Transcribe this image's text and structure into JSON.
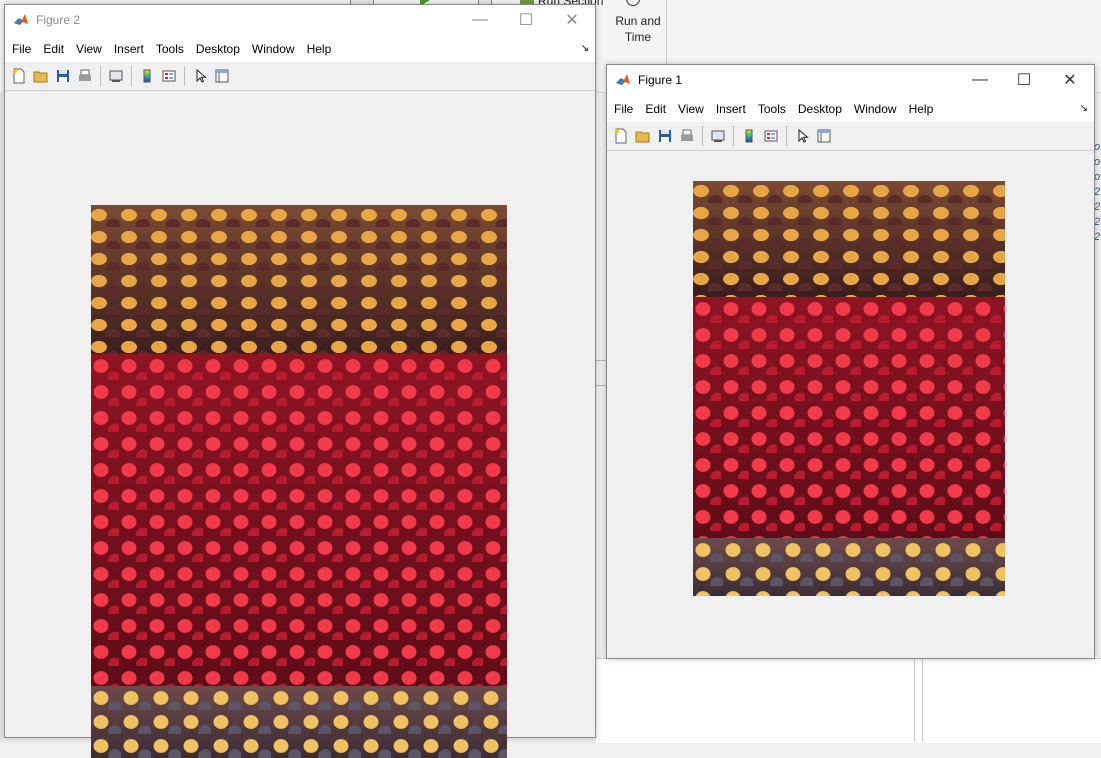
{
  "background": {
    "toolstrip": {
      "run_section_label": "Run Section",
      "run_and_time_label": "Run and\nTime"
    }
  },
  "figure2": {
    "title": "Figure 2",
    "menu": [
      "File",
      "Edit",
      "View",
      "Insert",
      "Tools",
      "Desktop",
      "Window",
      "Help"
    ],
    "toolbar_icons": [
      "new-figure-icon",
      "open-file-icon",
      "save-icon",
      "print-icon",
      "link-plot-icon",
      "insert-colorbar-icon",
      "insert-legend-icon",
      "edit-plot-icon",
      "property-inspector-icon"
    ],
    "image_alt": "corn-image"
  },
  "figure1": {
    "title": "Figure 1",
    "menu": [
      "File",
      "Edit",
      "View",
      "Insert",
      "Tools",
      "Desktop",
      "Window",
      "Help"
    ],
    "toolbar_icons": [
      "new-figure-icon",
      "open-file-icon",
      "save-icon",
      "print-icon",
      "link-plot-icon",
      "insert-colorbar-icon",
      "insert-legend-icon",
      "edit-plot-icon",
      "property-inspector-icon"
    ],
    "image_alt": "corn-image"
  },
  "window_controls": {
    "minimize": "—",
    "maximize": "☐",
    "close": "✕"
  },
  "colors": {
    "matlab_orange": "#e55d1f",
    "corn_red": "#d9263a",
    "corn_yellow": "#e8a544",
    "corn_dark": "#5a2b2a"
  }
}
